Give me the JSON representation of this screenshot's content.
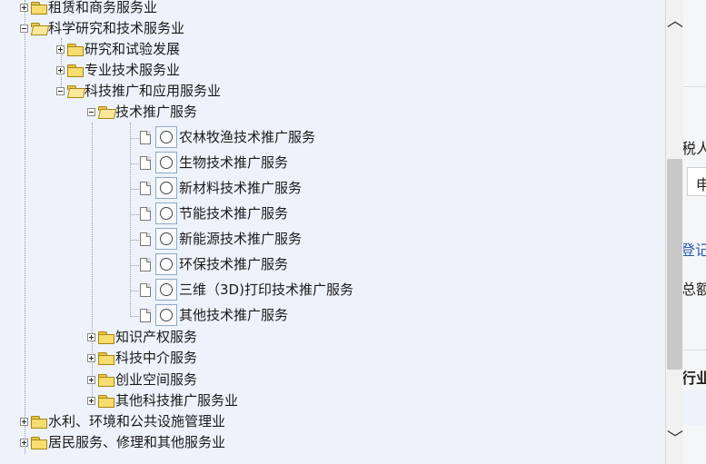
{
  "tree": {
    "nodes": [
      {
        "label": "租赁和商务服务业",
        "type": "folder",
        "state": "collapsed"
      },
      {
        "label": "科学研究和技术服务业",
        "type": "folder",
        "state": "expanded"
      },
      {
        "label": "研究和试验发展",
        "type": "folder",
        "state": "collapsed"
      },
      {
        "label": "专业技术服务业",
        "type": "folder",
        "state": "collapsed"
      },
      {
        "label": "科技推广和应用服务业",
        "type": "folder",
        "state": "expanded"
      },
      {
        "label": "技术推广服务",
        "type": "folder",
        "state": "expanded"
      },
      {
        "label": "农林牧渔技术推广服务",
        "type": "leaf"
      },
      {
        "label": "生物技术推广服务",
        "type": "leaf"
      },
      {
        "label": "新材料技术推广服务",
        "type": "leaf"
      },
      {
        "label": "节能技术推广服务",
        "type": "leaf"
      },
      {
        "label": "新能源技术推广服务",
        "type": "leaf"
      },
      {
        "label": "环保技术推广服务",
        "type": "leaf"
      },
      {
        "label": "三维（3D)打印技术推广服务",
        "type": "leaf"
      },
      {
        "label": "其他技术推广服务",
        "type": "leaf"
      },
      {
        "label": "知识产权服务",
        "type": "folder",
        "state": "collapsed"
      },
      {
        "label": "科技中介服务",
        "type": "folder",
        "state": "collapsed"
      },
      {
        "label": "创业空间服务",
        "type": "folder",
        "state": "collapsed"
      },
      {
        "label": "其他科技推广服务业",
        "type": "folder",
        "state": "collapsed"
      },
      {
        "label": "水利、环境和公共设施管理业",
        "type": "folder",
        "state": "collapsed"
      },
      {
        "label": "居民服务、修理和其他服务业",
        "type": "folder",
        "state": "collapsed"
      }
    ]
  },
  "scrollbar": {
    "up_icon": "chevron-up-icon",
    "down_icon": "chevron-down-icon",
    "up_glyph": "︿",
    "down_glyph": "﹀"
  },
  "background_page": {
    "text1": "税人",
    "text2": "申",
    "text3": "登记",
    "text4": "总额",
    "text5": "行业"
  },
  "colors": {
    "tree_bg": "#eef3fb",
    "folder": "#f7dc6e",
    "link": "#2a5db0"
  }
}
